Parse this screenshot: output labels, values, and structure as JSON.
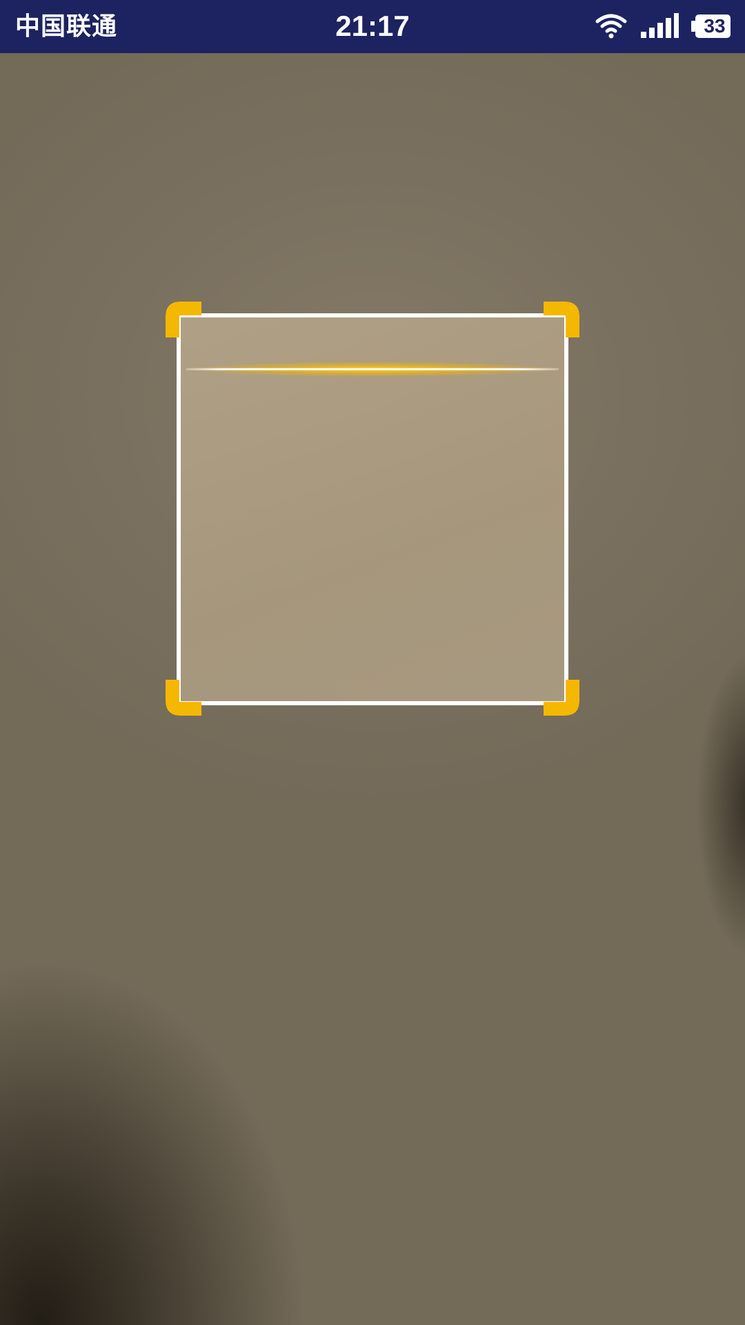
{
  "status_bar": {
    "carrier": "中国联通",
    "time": "21:17",
    "battery_level": "33",
    "icons": [
      "wifi-icon",
      "signal-icon",
      "battery-icon"
    ]
  },
  "scanner": {
    "frame_color": "#ffffff",
    "corner_color": "#f5b800",
    "scan_line_color": "#ffd21a"
  },
  "colors": {
    "status_bar_bg": "#1d2360"
  }
}
